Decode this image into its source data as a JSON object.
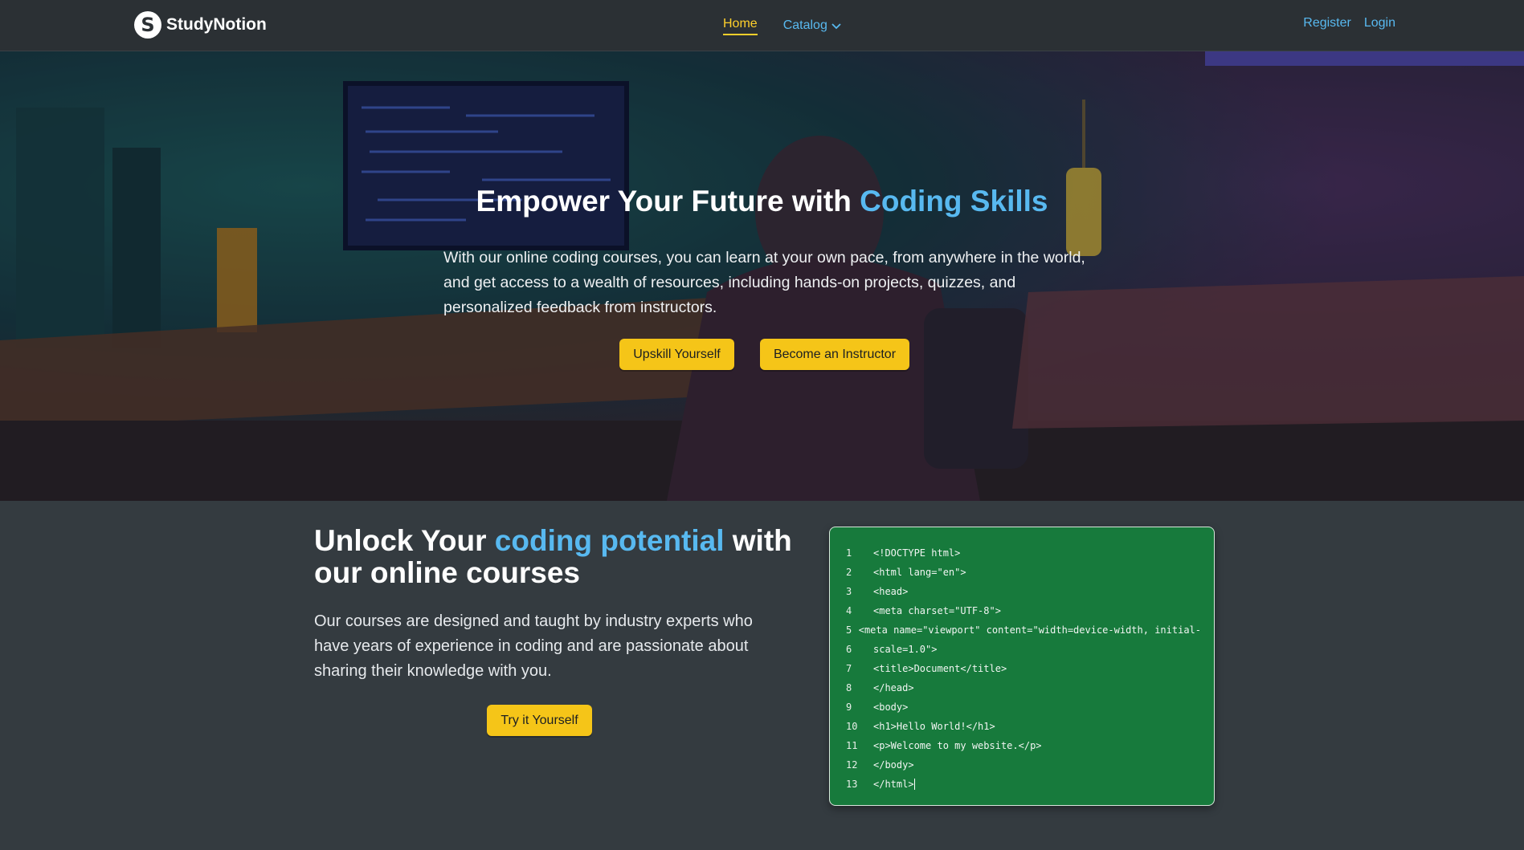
{
  "navbar": {
    "logo_letter": "S",
    "brand": "StudyNotion",
    "links": [
      {
        "label": "Home",
        "active": true
      },
      {
        "label": "Catalog",
        "active": false
      }
    ],
    "register": "Register",
    "login": "Login"
  },
  "hero": {
    "title_plain": "Empower Your Future with ",
    "title_accent": "Coding Skills",
    "description": "With our online coding courses, you can learn at your own pace, from anywhere in the world, and get access to a wealth of resources, including hands-on projects, quizzes, and personalized feedback from instructors.",
    "btn_upskill": "Upskill Yourself",
    "btn_instructor": "Become an Instructor"
  },
  "section": {
    "title_plain1": "Unlock Your ",
    "title_accent": "coding potential",
    "title_plain2": " with our online courses",
    "description": "Our courses are designed and taught by industry experts who have years of experience in coding and are passionate about sharing their knowledge with you.",
    "btn_try": "Try it Yourself"
  },
  "code": {
    "lines": [
      {
        "n": "1",
        "t": "<!DOCTYPE html>"
      },
      {
        "n": "2",
        "t": "<html lang=\"en\">"
      },
      {
        "n": "3",
        "t": "<head>"
      },
      {
        "n": "4",
        "t": "<meta charset=\"UTF-8\">"
      },
      {
        "n": "5",
        "t": "<meta name=\"viewport\" content=\"width=device-width, initial-"
      },
      {
        "n": "6",
        "t": "scale=1.0\">"
      },
      {
        "n": "7",
        "t": "<title>Document</title>"
      },
      {
        "n": "8",
        "t": "</head>"
      },
      {
        "n": "9",
        "t": "<body>"
      },
      {
        "n": "10",
        "t": "<h1>Hello World!</h1>"
      },
      {
        "n": "11",
        "t": "<p>Welcome to my website.</p>"
      },
      {
        "n": "12",
        "t": "</body>"
      },
      {
        "n": "13",
        "t": "</html>"
      }
    ]
  },
  "colors": {
    "accent_blue": "#58b9f0",
    "accent_yellow": "#ffd02b",
    "code_bg": "#177a3c",
    "page_bg": "#343b40"
  }
}
